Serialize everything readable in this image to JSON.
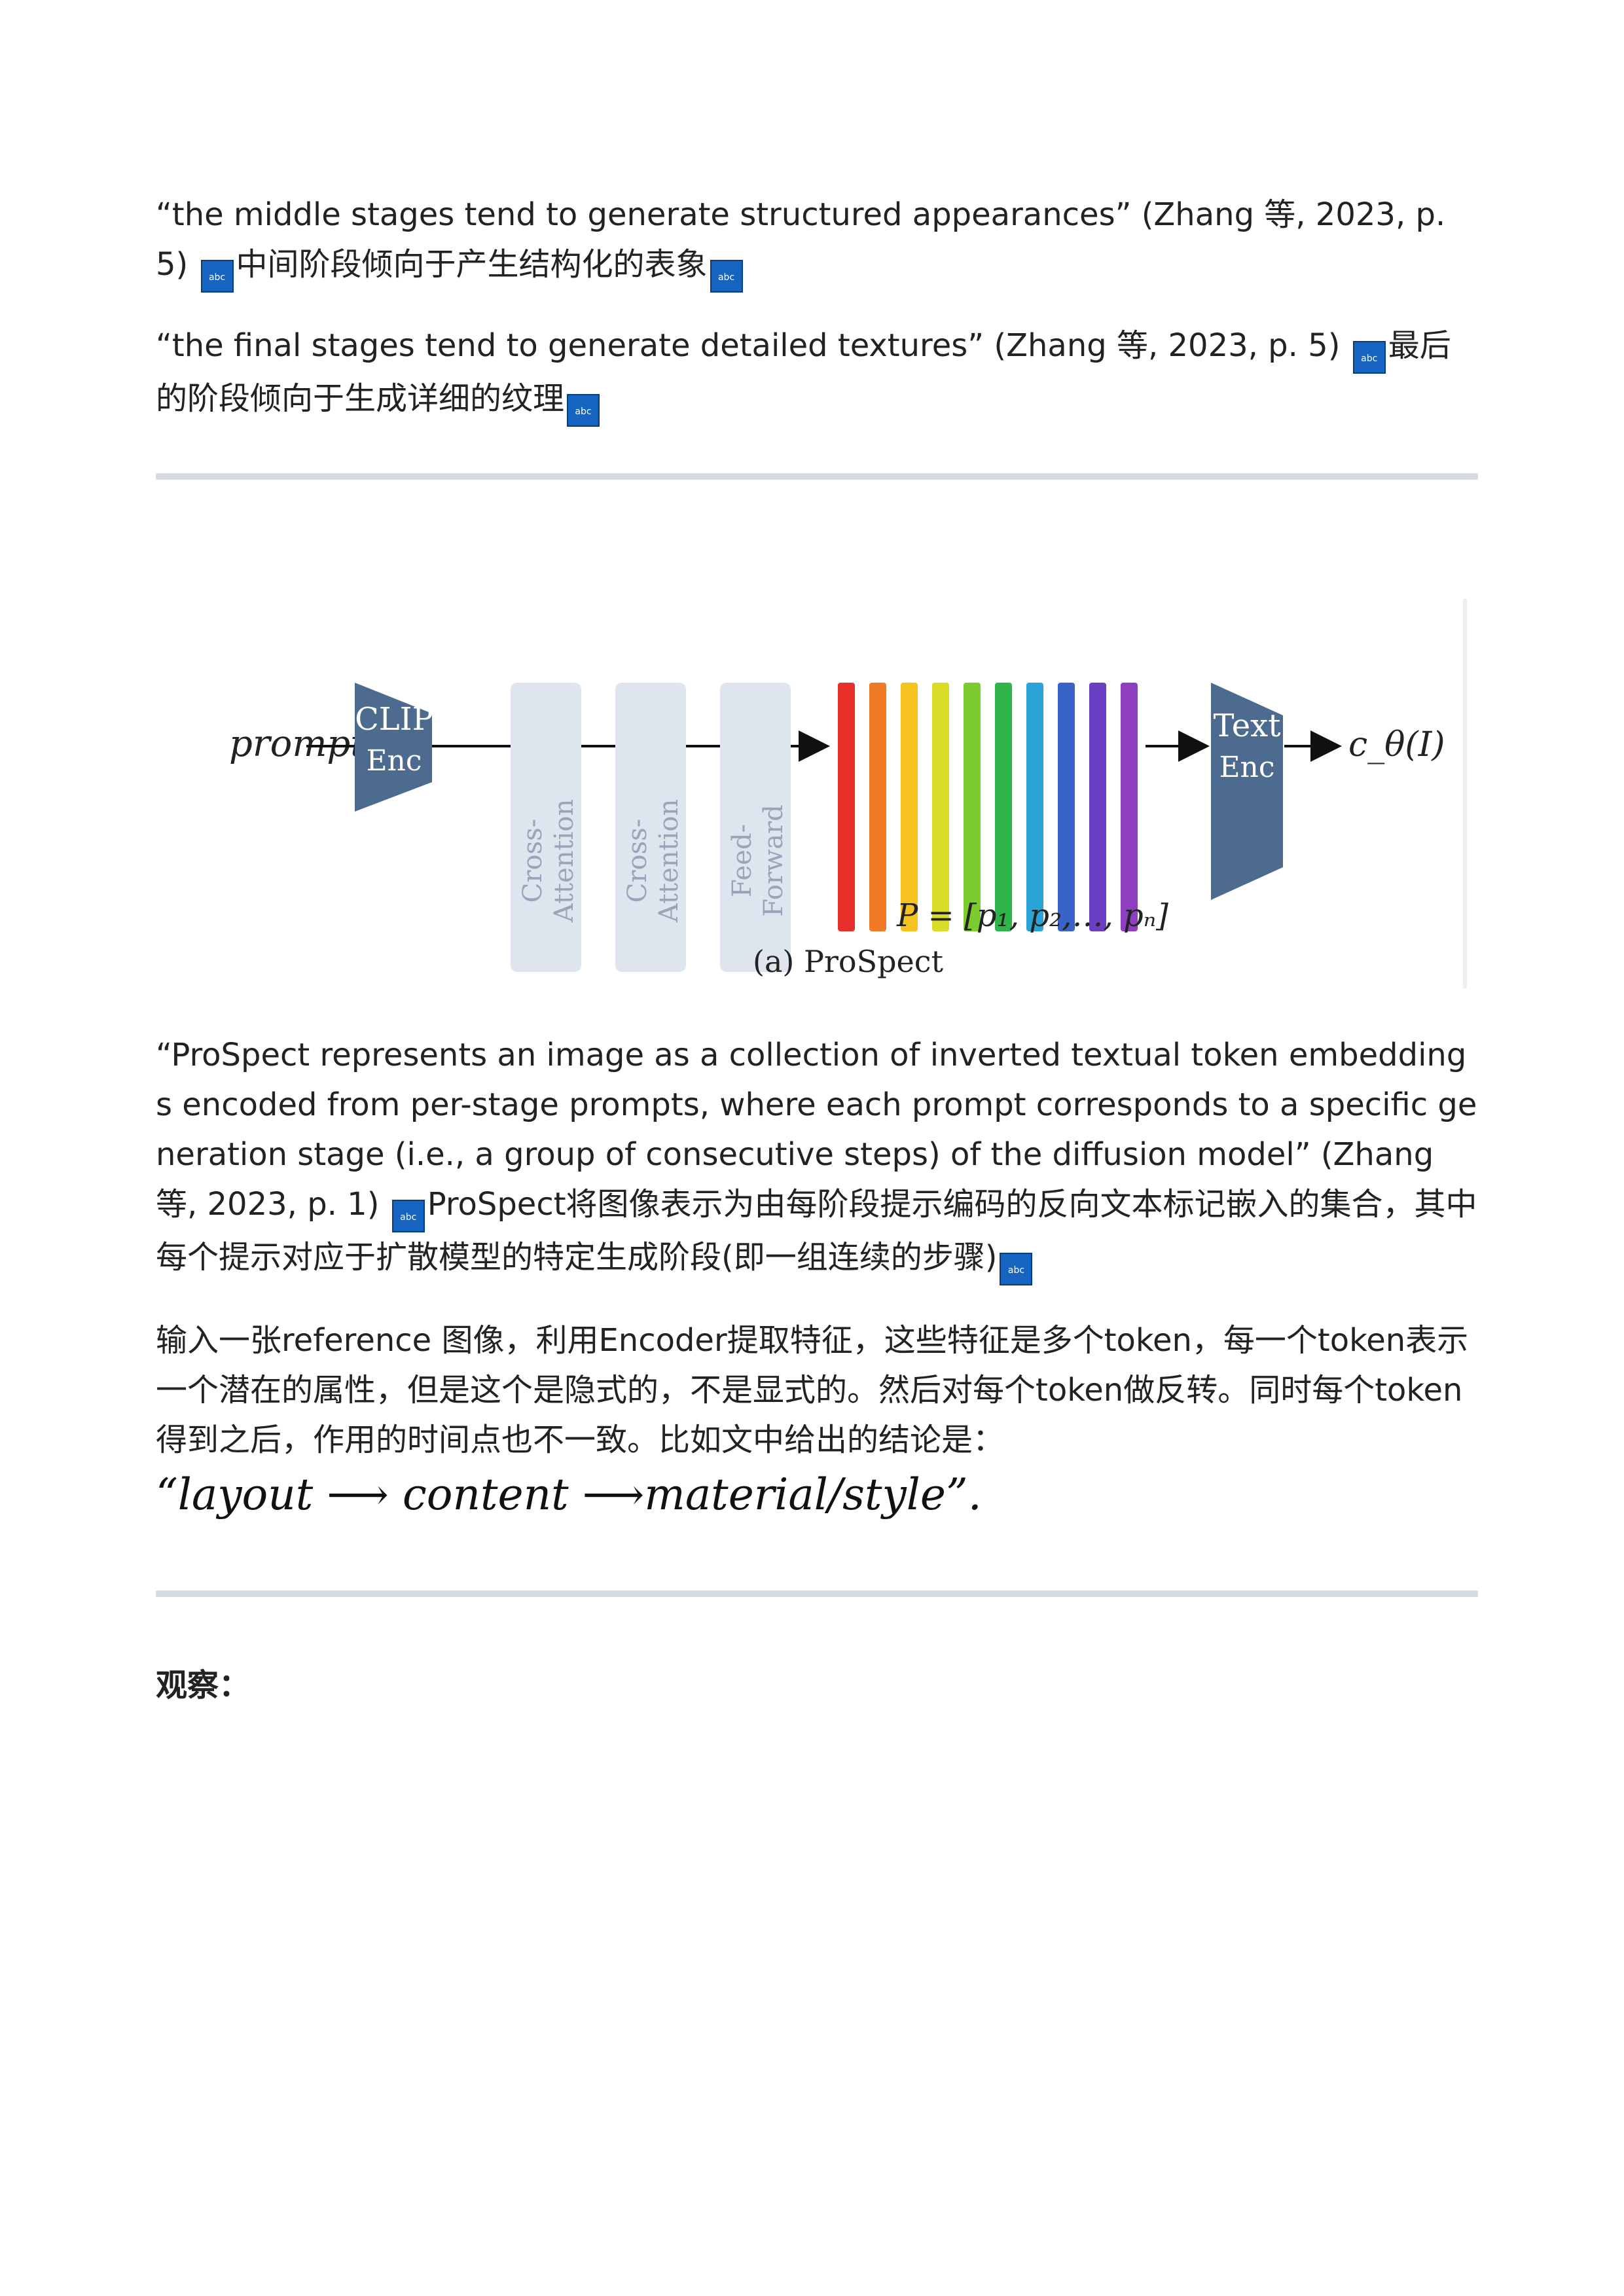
{
  "quotes": [
    {
      "en": "“the middle stages tend to generate structured appearances” (Zhang 等, 2023, p. 5)",
      "zh": "中间阶段倾向于产生结构化的表象"
    },
    {
      "en": "“the final stages tend to generate detailed textures” (Zhang 等, 2023, p. 5)",
      "zh": "最后的阶段倾向于生成详细的纹理"
    }
  ],
  "abc_icon_label": "abc",
  "figure": {
    "prompt_label": "prompt",
    "clip_enc": [
      "CLIP",
      "Enc"
    ],
    "blocks": [
      "Cross-\nAttention",
      "Cross-\nAttention",
      "Feed-\nForward"
    ],
    "bar_colors": [
      "#e8302a",
      "#f07a25",
      "#f5c21f",
      "#d9dc26",
      "#7ccc2f",
      "#2fb54a",
      "#2aa3d6",
      "#3a63c9",
      "#6b3fc3",
      "#8e3fbf"
    ],
    "text_enc": [
      "Text",
      "Enc"
    ],
    "output_label": "c_θ(I)",
    "p_formula": "P = [p₁, p₂,…, pₙ]",
    "caption": "(a) ProSpect"
  },
  "quote3": {
    "en": "“ProSpect represents an image as a collection of inverted textual token embeddings encoded from per-stage prompts, where each prompt corresponds to a specific generation stage (i.e., a group of consecutive steps) of the diffusion model” (Zhang 等, 2023, p. 1)",
    "zh": "ProSpect将图像表示为由每阶段提示编码的反向文本标记嵌入的集合，其中每个提示对应于扩散模型的特定生成阶段(即一组连续的步骤)"
  },
  "paragraph": "输入一张reference 图像，利用Encoder提取特征，这些特征是多个token，每一个token表示一个潜在的属性，但是这个是隐式的，不是显式的。然后对每个token做反转。同时每个token得到之后，作用的时间点也不一致。比如文中给出的结论是：",
  "formula": "“layout ⟶ content ⟶material/style”.",
  "heading": "观察："
}
